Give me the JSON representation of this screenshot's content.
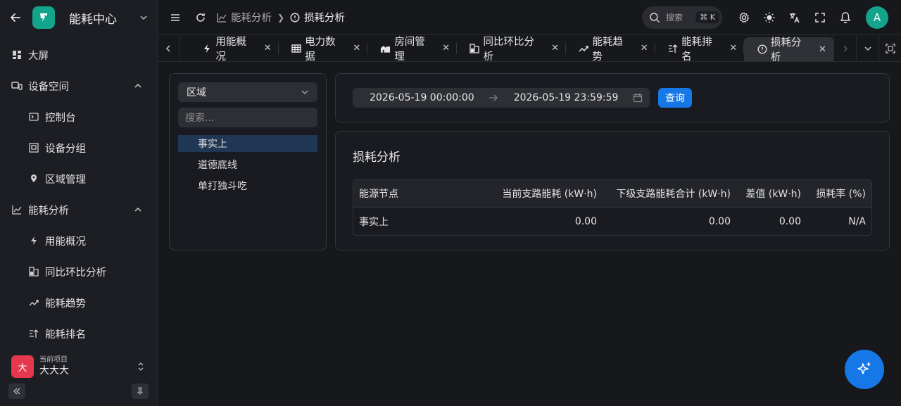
{
  "sidebar": {
    "title": "能耗中心",
    "items": [
      {
        "label": "大屏",
        "icon": "dashboard-icon"
      },
      {
        "label": "设备空间",
        "icon": "device-icon"
      },
      {
        "label": "控制台",
        "icon": "console-icon"
      },
      {
        "label": "设备分组",
        "icon": "group-icon"
      },
      {
        "label": "区域管理",
        "icon": "location-icon"
      },
      {
        "label": "能耗分析",
        "icon": "chart-line-icon"
      },
      {
        "label": "用能概况",
        "icon": "bolt-icon"
      },
      {
        "label": "同比环比分析",
        "icon": "compare-icon"
      },
      {
        "label": "能耗趋势",
        "icon": "trend-icon"
      },
      {
        "label": "能耗排名",
        "icon": "rank-icon"
      }
    ],
    "project": {
      "caption": "当前项目",
      "name": "大大大",
      "avatar": "大"
    }
  },
  "header": {
    "breadcrumb": [
      {
        "label": "能耗分析",
        "icon": "chart-line-icon"
      },
      {
        "label": "损耗分析",
        "icon": "alert-circle-icon"
      }
    ],
    "search": {
      "placeholder": "搜索",
      "shortcut": "⌘ K"
    },
    "avatar": "A"
  },
  "tabs": [
    {
      "label": "用能概况",
      "icon": "bolt-icon"
    },
    {
      "label": "电力数据",
      "icon": "grid-icon"
    },
    {
      "label": "房间管理",
      "icon": "building-icon"
    },
    {
      "label": "同比环比分析",
      "icon": "compare-icon"
    },
    {
      "label": "能耗趋势",
      "icon": "trend-icon"
    },
    {
      "label": "能耗排名",
      "icon": "rank-icon"
    },
    {
      "label": "损耗分析",
      "icon": "alert-circle-icon",
      "active": true
    }
  ],
  "left_panel": {
    "select_value": "区域",
    "search_placeholder": "搜索...",
    "tree": [
      "事实上",
      "道德底线",
      "单打独斗吃"
    ]
  },
  "filter": {
    "start": "2026-05-19 00:00:00",
    "end": "2026-05-19 23:59:59",
    "query_label": "查询"
  },
  "result": {
    "title": "损耗分析",
    "columns": [
      "能源节点",
      "当前支路能耗 (kW·h)",
      "下级支路能耗合计 (kW·h)",
      "差值 (kW·h)",
      "损耗率 (%)"
    ],
    "rows": [
      [
        "事实上",
        "0.00",
        "0.00",
        "0.00",
        "N/A"
      ]
    ]
  },
  "colors": {
    "accent": "#1677e6",
    "brand": "#14a38b",
    "project": "#e5384f"
  }
}
